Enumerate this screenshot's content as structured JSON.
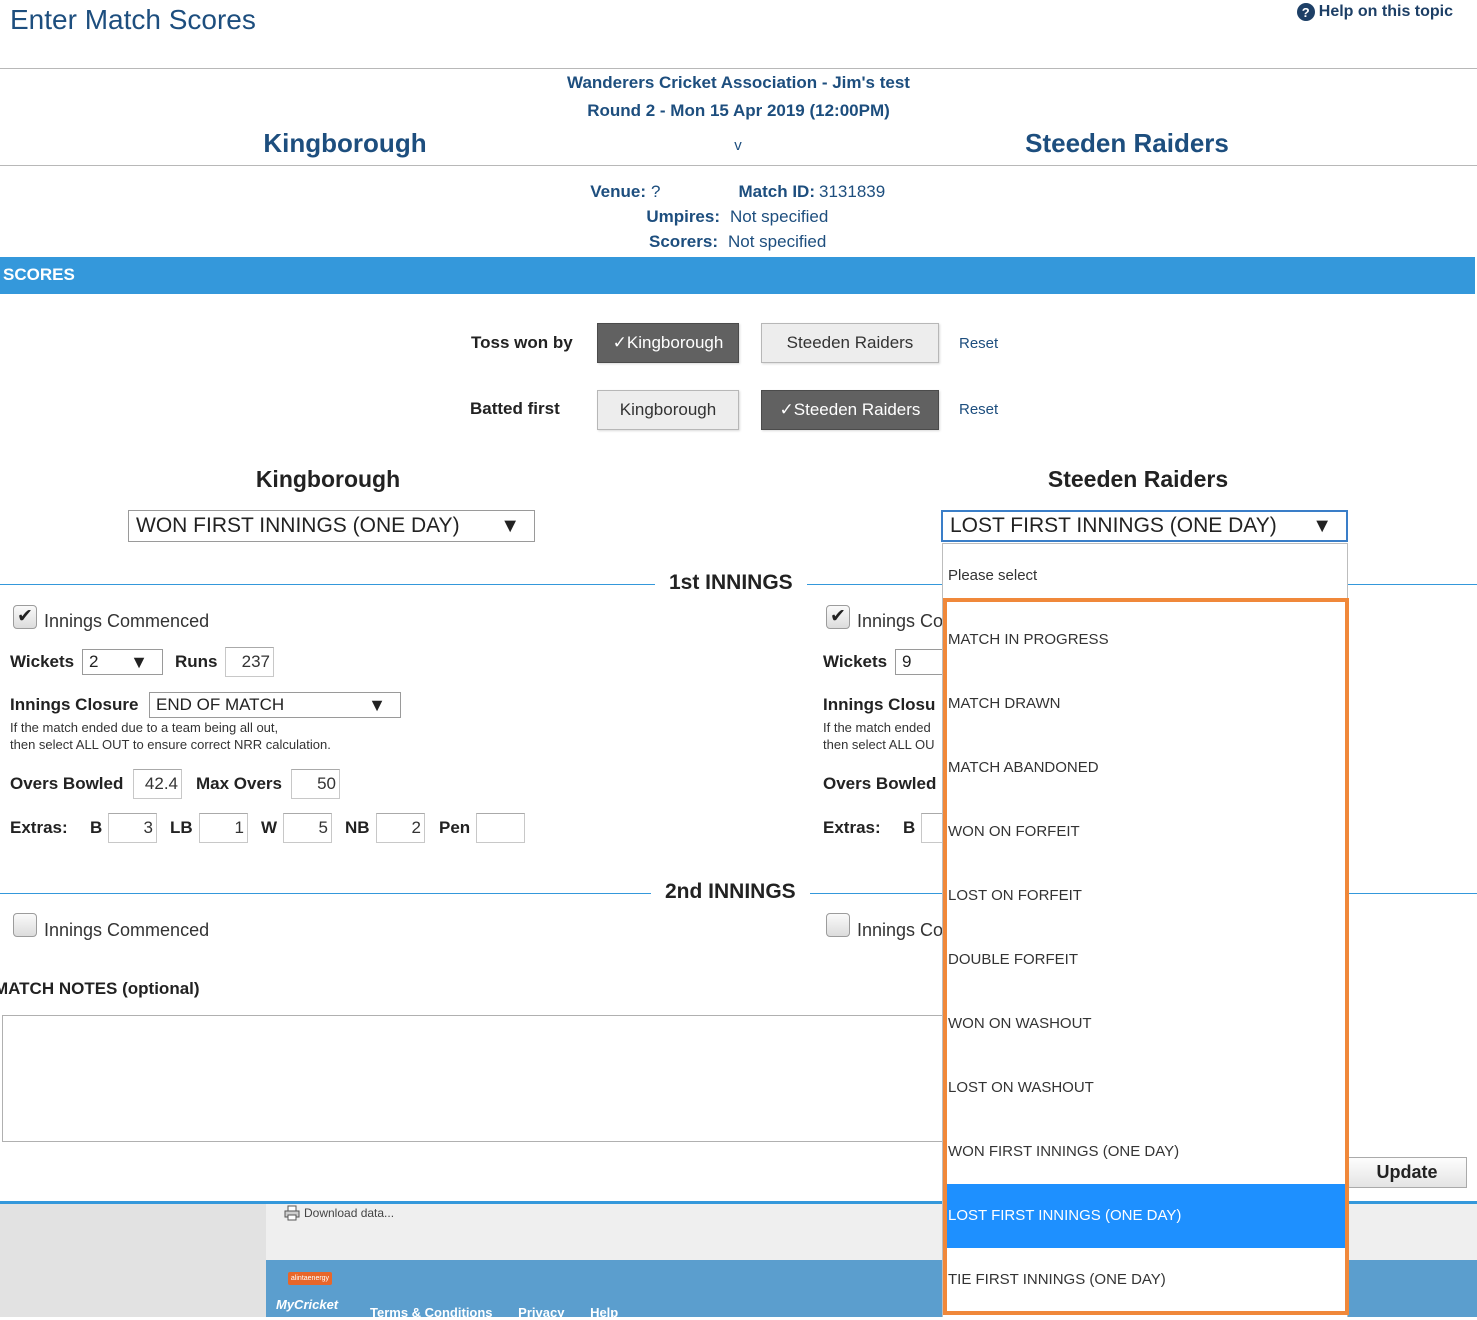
{
  "page": {
    "title": "Enter Match Scores",
    "help_label": "Help on this topic",
    "help_icon": "?"
  },
  "match": {
    "association": "Wanderers Cricket Association - Jim's test",
    "round": "Round 2 - Mon 15 Apr 2019 (12:00PM)",
    "home_team": "Kingborough",
    "vs": "v",
    "away_team": "Steeden Raiders",
    "venue_label": "Venue:",
    "venue_value": "?",
    "match_id_label": "Match ID:",
    "match_id_value": "3131839",
    "umpires_label": "Umpires:",
    "umpires_value": "Not specified",
    "scorers_label": "Scorers:",
    "scorers_value": "Not specified"
  },
  "scores": {
    "section_label": "SCORES",
    "toss_label": "Toss won by",
    "toss_options": [
      "✓Kingborough",
      "Steeden Raiders"
    ],
    "toss_selected": "Kingborough",
    "batted_label": "Batted first",
    "batted_options": [
      "Kingborough",
      "✓Steeden Raiders"
    ],
    "batted_selected": "Steeden Raiders",
    "reset_label": "Reset"
  },
  "teams": {
    "left": {
      "name": "Kingborough",
      "result": "WON FIRST INNINGS (ONE DAY)"
    },
    "right": {
      "name": "Steeden Raiders",
      "result": "LOST FIRST INNINGS (ONE DAY)"
    }
  },
  "innings1": {
    "title": "1st INNINGS",
    "left": {
      "commenced_label": "Innings Commenced",
      "commenced": true,
      "wickets_label": "Wickets",
      "wickets": "2",
      "runs_label": "Runs",
      "runs": "237",
      "closure_label": "Innings Closure",
      "closure": "END OF MATCH",
      "hint_line1": "If the match ended due to a team being all out,",
      "hint_line2": "then select ALL OUT to ensure correct NRR calculation.",
      "overs_label": "Overs Bowled",
      "overs": "42.4",
      "max_overs_label": "Max Overs",
      "max_overs": "50",
      "extras_label": "Extras:",
      "b_label": "B",
      "b": "3",
      "lb_label": "LB",
      "lb": "1",
      "w_label": "W",
      "w": "5",
      "nb_label": "NB",
      "nb": "2",
      "pen_label": "Pen",
      "pen": ""
    },
    "right": {
      "commenced_label": "Innings Co",
      "commenced": true,
      "wickets_label": "Wickets",
      "wickets": "9",
      "closure_label": "Innings Closu",
      "hint_line1": "If the match ended",
      "hint_line2": "then select ALL OU",
      "overs_label": "Overs Bowled",
      "extras_label": "Extras:",
      "b_label": "B"
    }
  },
  "innings2": {
    "title": "2nd INNINGS",
    "left_commenced_label": "Innings Commenced",
    "right_commenced_label": "Innings Co"
  },
  "notes": {
    "label": "MATCH NOTES (optional)",
    "value": ""
  },
  "update_label": "Update",
  "footer": {
    "download_label": "Download data...",
    "logo_small": "alintaenergy",
    "logo_text": "MyCricket",
    "links": [
      "Terms & Conditions",
      "Privacy",
      "Help"
    ]
  },
  "dropdown": {
    "placeholder": "Please select",
    "options": [
      "MATCH IN PROGRESS",
      "MATCH DRAWN",
      "MATCH ABANDONED",
      "WON ON FORFEIT",
      "LOST ON FORFEIT",
      "DOUBLE FORFEIT",
      "WON ON WASHOUT",
      "LOST ON WASHOUT",
      "WON FIRST INNINGS (ONE DAY)",
      "LOST FIRST INNINGS (ONE DAY)",
      "TIE FIRST INNINGS (ONE DAY)"
    ],
    "selected": "LOST FIRST INNINGS (ONE DAY)",
    "highlight_color": "#1e90ff",
    "annotation_color": "#f0883a"
  }
}
